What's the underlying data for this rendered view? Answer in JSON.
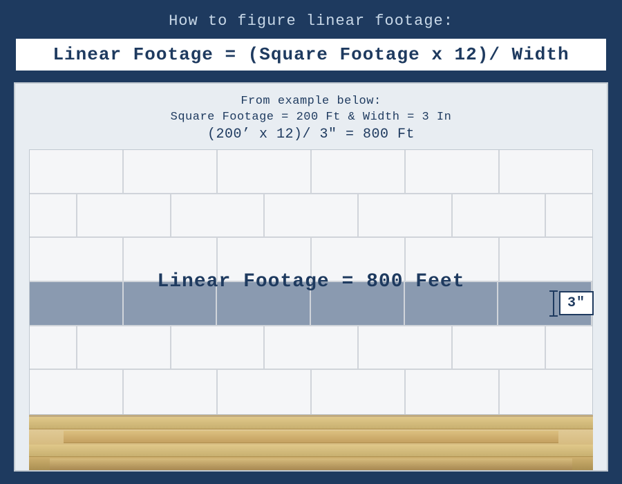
{
  "header": {
    "title": "How to figure linear footage:"
  },
  "formula": {
    "text": "Linear Footage = (Square Footage x 12)/ Width"
  },
  "example": {
    "intro": "From example below:",
    "given": "Square Footage = 200 Ft & Width = 3 In",
    "calc": "(200’ x 12)/  3″ = 800  Ft"
  },
  "result": {
    "label": "Linear Footage = 800 Feet"
  },
  "width_indicator": {
    "label": "3″"
  }
}
